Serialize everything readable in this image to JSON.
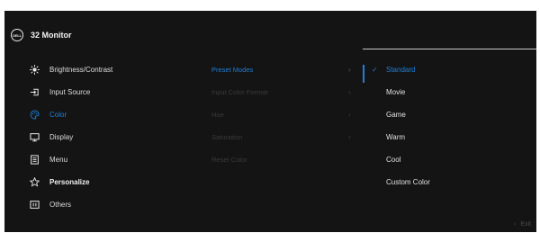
{
  "header": {
    "logo_text": "DELL",
    "title": "32 Monitor"
  },
  "menu": {
    "items": [
      {
        "label": "Brightness/Contrast",
        "icon": "brightness-icon"
      },
      {
        "label": "Input Source",
        "icon": "input-source-icon"
      },
      {
        "label": "Color",
        "icon": "color-palette-icon",
        "active": true
      },
      {
        "label": "Display",
        "icon": "display-icon"
      },
      {
        "label": "Menu",
        "icon": "menu-icon"
      },
      {
        "label": "Personalize",
        "icon": "star-icon",
        "bold": true
      },
      {
        "label": "Others",
        "icon": "others-icon"
      }
    ]
  },
  "submenu": {
    "items": [
      {
        "label": "Preset Modes",
        "active": true
      },
      {
        "label": "Input Color Format"
      },
      {
        "label": "Hue"
      },
      {
        "label": "Saturation"
      },
      {
        "label": "Reset Color"
      }
    ]
  },
  "options": {
    "items": [
      {
        "label": "Standard",
        "selected": true
      },
      {
        "label": "Movie"
      },
      {
        "label": "Game"
      },
      {
        "label": "Warm"
      },
      {
        "label": "Cool"
      },
      {
        "label": "Custom Color"
      }
    ]
  },
  "footer": {
    "exit_label": "Exit"
  },
  "colors": {
    "accent": "#1f7fd6",
    "background": "#141414",
    "text": "#e8e8e8",
    "disabled": "#3a3a3a"
  }
}
